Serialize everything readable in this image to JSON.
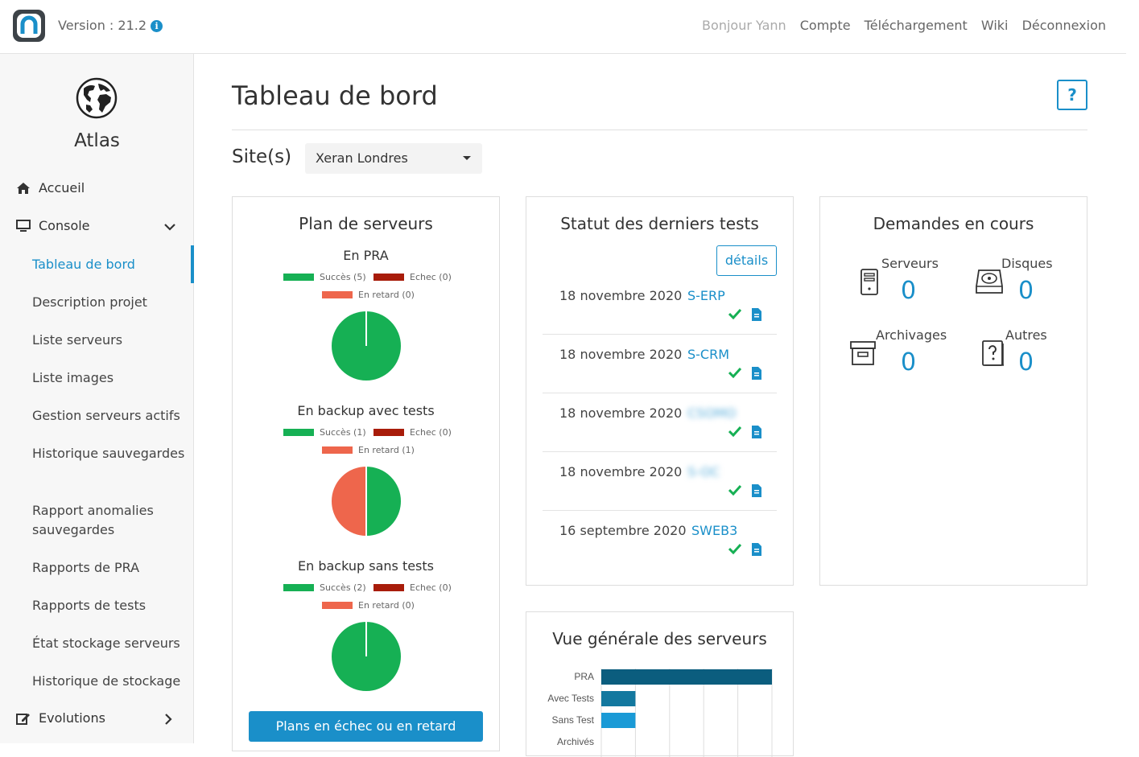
{
  "topbar": {
    "version_label": "Version : 21.2",
    "info_icon_glyph": "i",
    "nav": [
      "Bonjour Yann",
      "Compte",
      "Téléchargement",
      "Wiki",
      "Déconnexion"
    ]
  },
  "sidebar": {
    "app_name": "Atlas",
    "accueil": "Accueil",
    "console": "Console",
    "items": [
      "Tableau de bord",
      "Description projet",
      "Liste serveurs",
      "Liste images",
      "Gestion serveurs actifs",
      "Historique sauvegardes",
      "Rapport anomalies sauvegardes",
      "Rapports de PRA",
      "Rapports de tests",
      "État stockage serveurs",
      "Historique de stockage"
    ],
    "evolutions": "Evolutions"
  },
  "main": {
    "title": "Tableau de bord",
    "help_label": "?",
    "site_label": "Site(s)",
    "site_value": "Xeran Londres"
  },
  "plan": {
    "title": "Plan de serveurs",
    "groups": [
      {
        "title": "En PRA",
        "success": "Succès (5)",
        "fail": "Echec (0)",
        "late": "En retard (0)",
        "success_n": 5,
        "fail_n": 0,
        "late_n": 0
      },
      {
        "title": "En backup avec tests",
        "success": "Succès (1)",
        "fail": "Echec (0)",
        "late": "En retard (1)",
        "success_n": 1,
        "fail_n": 0,
        "late_n": 1
      },
      {
        "title": "En backup sans tests",
        "success": "Succès (2)",
        "fail": "Echec (0)",
        "late": "En retard (0)",
        "success_n": 2,
        "fail_n": 0,
        "late_n": 0
      }
    ],
    "button": "Plans en échec ou en retard"
  },
  "tests": {
    "title": "Statut des derniers tests",
    "details": "détails",
    "rows": [
      {
        "date": "18 novembre 2020",
        "name": "S-ERP"
      },
      {
        "date": "18 novembre 2020",
        "name": "S-CRM"
      },
      {
        "date": "18 novembre 2020",
        "name": "CSOMO"
      },
      {
        "date": "18 novembre 2020",
        "name": "S-OC"
      },
      {
        "date": "16 septembre 2020",
        "name": "SWEB3"
      }
    ]
  },
  "demandes": {
    "title": "Demandes en cours",
    "serveurs": "Serveurs",
    "serveurs_val": "0",
    "disques": "Disques",
    "disques_val": "0",
    "archivages": "Archivages",
    "archivages_val": "0",
    "autres": "Autres",
    "autres_val": "0"
  },
  "overview": {
    "title": "Vue générale des serveurs"
  },
  "chart_data": {
    "type": "bar",
    "orientation": "horizontal",
    "categories": [
      "PRA",
      "Avec Tests",
      "Sans Test",
      "Archivés"
    ],
    "values": [
      5,
      1,
      1,
      null
    ],
    "colors": [
      "#0b5d7e",
      "#13789f",
      "#1a9ad6"
    ],
    "xlim": [
      0,
      5
    ],
    "grid": true
  }
}
